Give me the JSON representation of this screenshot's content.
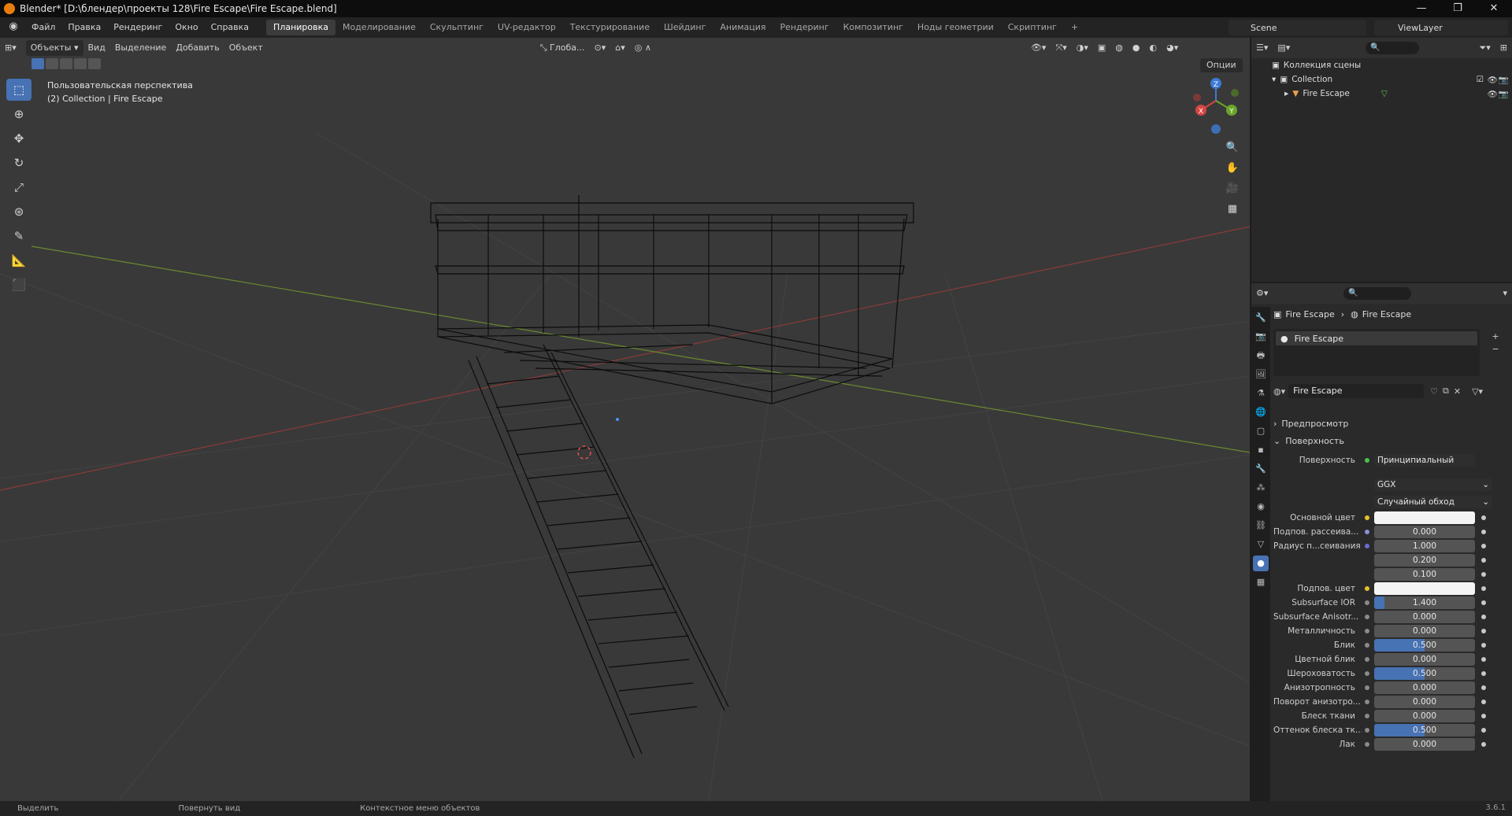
{
  "title_bar": {
    "text": "Blender* [D:\\блендер\\проекты 128\\Fire Escape\\Fire Escape.blend]",
    "buttons": [
      "—",
      "❐",
      "✕"
    ]
  },
  "menu": {
    "items": [
      "Файл",
      "Правка",
      "Рендеринг",
      "Окно",
      "Справка"
    ]
  },
  "workspaces": {
    "tabs": [
      "Планировка",
      "Моделирование",
      "Скульптинг",
      "UV-редактор",
      "Текстурирование",
      "Шейдинг",
      "Анимация",
      "Рендеринг",
      "Композитинг",
      "Ноды геометрии",
      "Скриптинг",
      "+"
    ],
    "active": "Планировка"
  },
  "scene": {
    "name": "Scene"
  },
  "view_layer": {
    "name": "ViewLayer"
  },
  "viewport": {
    "mode": "Объекты",
    "menus": [
      "Вид",
      "Выделение",
      "Добавить",
      "Объект"
    ],
    "transform_orientation": "Глоба...",
    "options": "Опции",
    "info_line1": "Пользовательская перспектива",
    "info_line2": "(2) Collection | Fire Escape",
    "gizmo": {
      "x": "X",
      "y": "Y",
      "z": "Z"
    }
  },
  "outliner": {
    "search_placeholder": "",
    "scene_collection": "Коллекция сцены",
    "collection": "Collection",
    "object": "Fire Escape"
  },
  "properties": {
    "breadcrumb": [
      "Fire Escape",
      "Fire Escape"
    ],
    "slot": "Fire Escape",
    "material": "Fire Escape",
    "panels": {
      "preview": "Предпросмотр",
      "surface": "Поверхность"
    },
    "surface_label": "Поверхность",
    "surface_value": "Принципиальный BSDF",
    "distribution": "GGX",
    "subsurface_method": "Случайный обход",
    "rows": [
      {
        "label": "Основной цвет",
        "value": "",
        "swatch": "#f4f4f4",
        "dot": "#e6c02c"
      },
      {
        "label": "Подпов. рассеива...",
        "value": "0.000",
        "fill": 0,
        "dot": "#8a8fd6"
      },
      {
        "label": "Радиус п...сеивания",
        "value": "1.000",
        "fill": 0,
        "dot": "#6b6bd0"
      },
      {
        "label": "",
        "value": "0.200",
        "fill": 0,
        "dot": ""
      },
      {
        "label": "",
        "value": "0.100",
        "fill": 0,
        "dot": ""
      },
      {
        "label": "Подпов. цвет",
        "value": "",
        "swatch": "#f4f4f4",
        "dot": "#e6c02c"
      },
      {
        "label": "Subsurface IOR",
        "value": "1.400",
        "fill": 0.1,
        "dot": "#8a8a8a"
      },
      {
        "label": "Subsurface Anisotr...",
        "value": "0.000",
        "fill": 0,
        "dot": "#8a8a8a"
      },
      {
        "label": "Металличность",
        "value": "0.000",
        "fill": 0,
        "dot": "#8a8a8a"
      },
      {
        "label": "Блик",
        "value": "0.500",
        "fill": 0.5,
        "dot": "#8a8a8a"
      },
      {
        "label": "Цветной блик",
        "value": "0.000",
        "fill": 0,
        "dot": "#8a8a8a"
      },
      {
        "label": "Шероховатость",
        "value": "0.500",
        "fill": 0.5,
        "dot": "#8a8a8a"
      },
      {
        "label": "Анизотропность",
        "value": "0.000",
        "fill": 0,
        "dot": "#8a8a8a"
      },
      {
        "label": "Поворот анизотро...",
        "value": "0.000",
        "fill": 0,
        "dot": "#8a8a8a"
      },
      {
        "label": "Блеск ткани",
        "value": "0.000",
        "fill": 0,
        "dot": "#8a8a8a"
      },
      {
        "label": "Оттенок блеска тк...",
        "value": "0.500",
        "fill": 0.5,
        "dot": "#8a8a8a"
      },
      {
        "label": "Лак",
        "value": "0.000",
        "fill": 0,
        "dot": "#8a8a8a"
      }
    ]
  },
  "status_bar": {
    "items": [
      "Выделить",
      "Повернуть вид",
      "Контекстное меню объектов"
    ],
    "version": "3.6.1"
  }
}
